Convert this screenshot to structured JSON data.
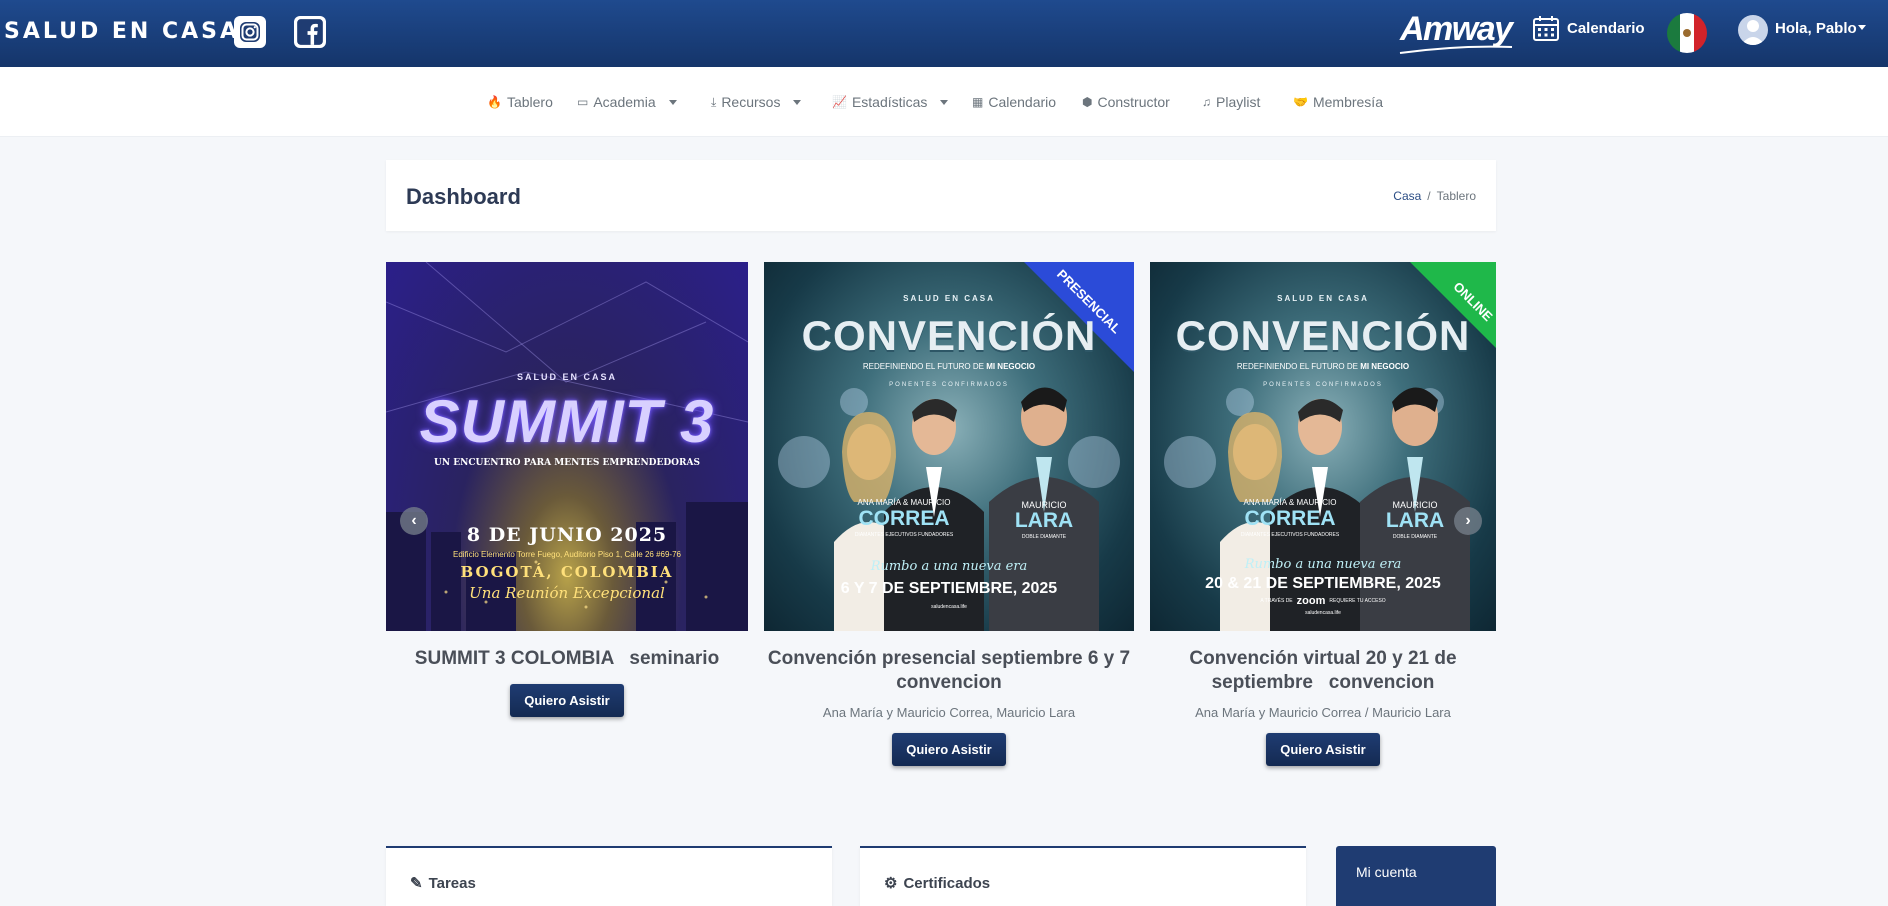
{
  "header": {
    "brand": "SALUD EN CASA",
    "amway_logo": "Amway",
    "calendar_label": "Calendario",
    "user_greeting": "Hola, Pablo",
    "flag": "Mexico",
    "colors": {
      "topbar": "#1f4a8e",
      "accent": "#1f3c72"
    }
  },
  "nav": {
    "items": [
      {
        "label": "Tablero",
        "icon": "fire-icon"
      },
      {
        "label": "Academia",
        "icon": "teacher-icon",
        "dropdown": true
      },
      {
        "label": "Recursos",
        "icon": "download-icon",
        "dropdown": true
      },
      {
        "label": "Estadísticas",
        "icon": "line-chart-icon",
        "dropdown": true
      },
      {
        "label": "Calendario",
        "icon": "calendar-icon"
      },
      {
        "label": "Constructor",
        "icon": "cubes-icon"
      },
      {
        "label": "Playlist",
        "icon": "music-icon"
      },
      {
        "label": "Membresía",
        "icon": "handshake-icon"
      }
    ]
  },
  "page": {
    "title": "Dashboard",
    "breadcrumb": [
      "Casa",
      "/",
      "Tablero"
    ]
  },
  "events": [
    {
      "title": "SUMMIT 3 COLOMBIA   seminario",
      "subtitle": "",
      "button": "Quiero Asistir",
      "poster": {
        "org": "SALUD EN CASA",
        "headline": "SUMMIT 3",
        "tagline": "UN ENCUENTRO PARA MENTES EMPRENDEDORAS",
        "date": "8 DE JUNIO 2025",
        "venue": "Edificio Elemento Torre Fuego, Auditorio Piso 1, Calle 26 #69-76",
        "city": "BOGOTÁ, COLOMBIA",
        "slogan": "Una Reunión Excepcional"
      }
    },
    {
      "title": "Convención presencial septiembre 6 y 7 convencion",
      "subtitle": "Ana María y Mauricio Correa, Mauricio Lara",
      "button": "Quiero Asistir",
      "poster": {
        "org": "SALUD EN CASA",
        "headline": "CONVENCIÓN",
        "tagline_pre": "REDEFINIENDO EL FUTURO DE ",
        "tagline_bold": "MI NEGOCIO",
        "speakers_label": "PONENTES CONFIRMADOS",
        "speaker1_names": "ANA MARÍA & MAURICIO",
        "speaker1_last": "CORREA",
        "speaker1_rank": "DIAMANTES EJECUTIVOS FUNDADORES",
        "speaker2_names": "MAURICIO",
        "speaker2_last": "LARA",
        "speaker2_rank": "DOBLE DIAMANTE",
        "slogan": "Rumbo a una nueva era",
        "date": "6 Y 7 DE SEPTIEMBRE, 2025",
        "ribbon": "PRESENCIAL",
        "ribbon_color": "#2b4bd8",
        "footer": "saludencasa.life"
      }
    },
    {
      "title": "Convención virtual 20 y 21 de septiembre   convencion",
      "subtitle": "Ana María y Mauricio Correa / Mauricio Lara",
      "button": "Quiero Asistir",
      "poster": {
        "org": "SALUD EN CASA",
        "headline": "CONVENCIÓN",
        "tagline_pre": "REDEFINIENDO EL FUTURO DE ",
        "tagline_bold": "MI NEGOCIO",
        "speakers_label": "PONENTES CONFIRMADOS",
        "speaker1_names": "ANA MARÍA & MAURICIO",
        "speaker1_last": "CORREA",
        "speaker1_rank": "DIAMANTES EJECUTIVOS FUNDADORES",
        "speaker2_names": "MAURICIO",
        "speaker2_last": "LARA",
        "speaker2_rank": "DOBLE DIAMANTE",
        "slogan": "Rumbo a una nueva era",
        "date": "20 & 21 DE SEPTIEMBRE, 2025",
        "ribbon": "ONLINE",
        "ribbon_color": "#1fb84a",
        "via": "A TRAVÉS DE",
        "zoom": "zoom",
        "zoom_note": "REQUIERE TU ACCESO",
        "footer": "saludencasa.life"
      }
    }
  ],
  "panels": {
    "tasks": "Tareas",
    "certificates": "Certificados",
    "account": "Mi cuenta"
  }
}
